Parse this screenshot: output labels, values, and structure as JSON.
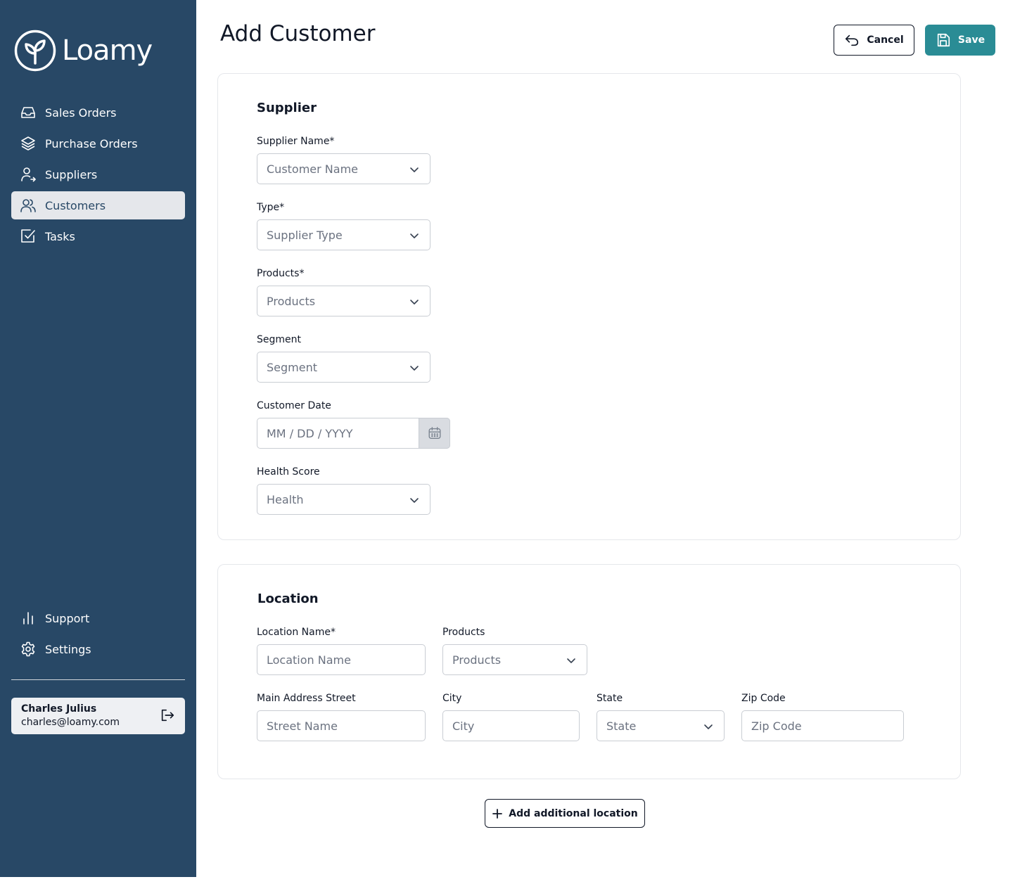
{
  "brand": {
    "name": "Loamy",
    "sidebar_color": "#284866",
    "accent": "#2a8c95"
  },
  "nav": {
    "items": [
      {
        "label": "Sales Orders",
        "icon": "inbox-icon"
      },
      {
        "label": "Purchase Orders",
        "icon": "layers-icon"
      },
      {
        "label": "Suppliers",
        "icon": "user-arrow-icon"
      },
      {
        "label": "Customers",
        "icon": "users-icon",
        "active": true
      },
      {
        "label": "Tasks",
        "icon": "checkbox-icon"
      }
    ],
    "bottom": [
      {
        "label": "Support",
        "icon": "bar-chart-icon"
      },
      {
        "label": "Settings",
        "icon": "gear-icon"
      }
    ]
  },
  "user": {
    "name": "Charles Julius",
    "email": "charles@loamy.com"
  },
  "header": {
    "title": "Add Customer",
    "cancel_label": "Cancel",
    "save_label": "Save"
  },
  "supplier_section": {
    "title": "Supplier",
    "supplier_name": {
      "label": "Supplier Name*",
      "placeholder": "Customer Name"
    },
    "type": {
      "label": "Type*",
      "placeholder": "Supplier Type"
    },
    "products": {
      "label": "Products*",
      "placeholder": "Products"
    },
    "segment": {
      "label": "Segment",
      "placeholder": "Segment"
    },
    "customer_date": {
      "label": "Customer Date",
      "placeholder": "MM / DD / YYYY"
    },
    "health_score": {
      "label": "Health Score",
      "placeholder": "Health"
    }
  },
  "location_section": {
    "title": "Location",
    "location_name": {
      "label": "Location Name*",
      "placeholder": "Location Name"
    },
    "products": {
      "label": "Products",
      "placeholder": "Products"
    },
    "street": {
      "label": "Main Address Street",
      "placeholder": "Street Name"
    },
    "city": {
      "label": "City",
      "placeholder": "City"
    },
    "state": {
      "label": "State",
      "placeholder": "State"
    },
    "zip": {
      "label": "Zip Code",
      "placeholder": "Zip Code"
    }
  },
  "add_location_label": "Add additional location"
}
